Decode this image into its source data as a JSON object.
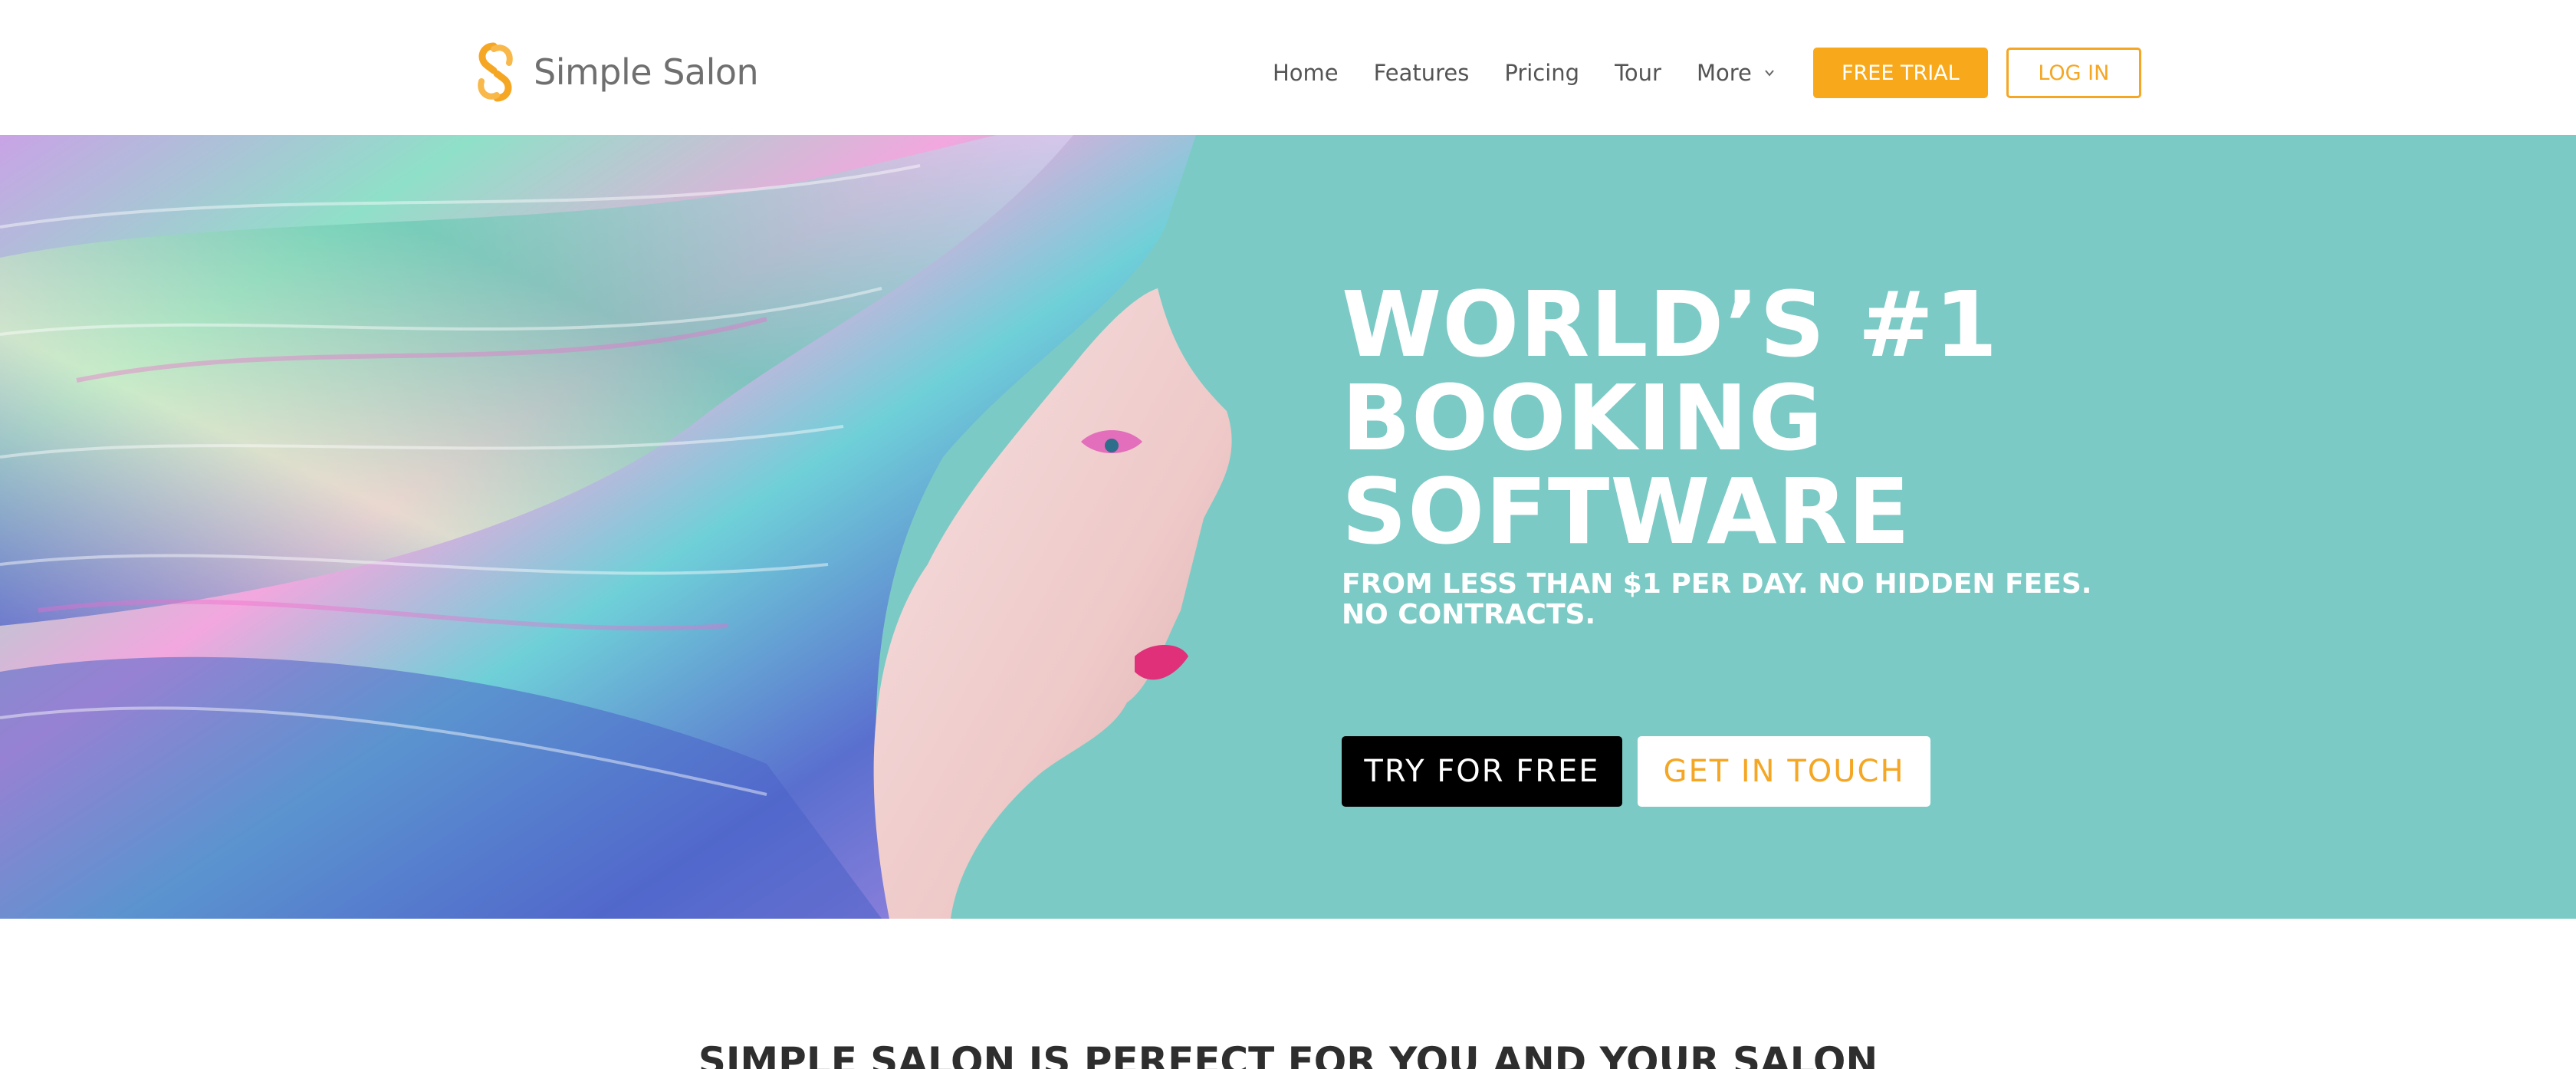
{
  "header": {
    "logo_text": "Simple Salon",
    "nav": [
      {
        "label": "Home"
      },
      {
        "label": "Features"
      },
      {
        "label": "Pricing"
      },
      {
        "label": "Tour"
      },
      {
        "label": "More"
      }
    ],
    "free_trial_label": "FREE TRIAL",
    "login_label": "LOG IN"
  },
  "hero": {
    "title_lines": [
      "WORLD’S #1",
      "BOOKING",
      "SOFTWARE"
    ],
    "subtitle": "FROM LESS THAN $1 PER DAY. NO HIDDEN FEES. NO CONTRACTS.",
    "try_label": "TRY FOR FREE",
    "touch_label": "GET IN TOUCH",
    "background_color": "#7ccac5"
  },
  "section": {
    "title": "SIMPLE SALON IS PERFECT FOR YOU AND YOUR SALON"
  },
  "colors": {
    "accent": "#f8a91b",
    "hero_bg": "#7ccac5",
    "dark_button": "#000000"
  },
  "icons": {
    "logo": "simple-salon-logo-mark",
    "more_dropdown": "chevron-down-icon"
  }
}
